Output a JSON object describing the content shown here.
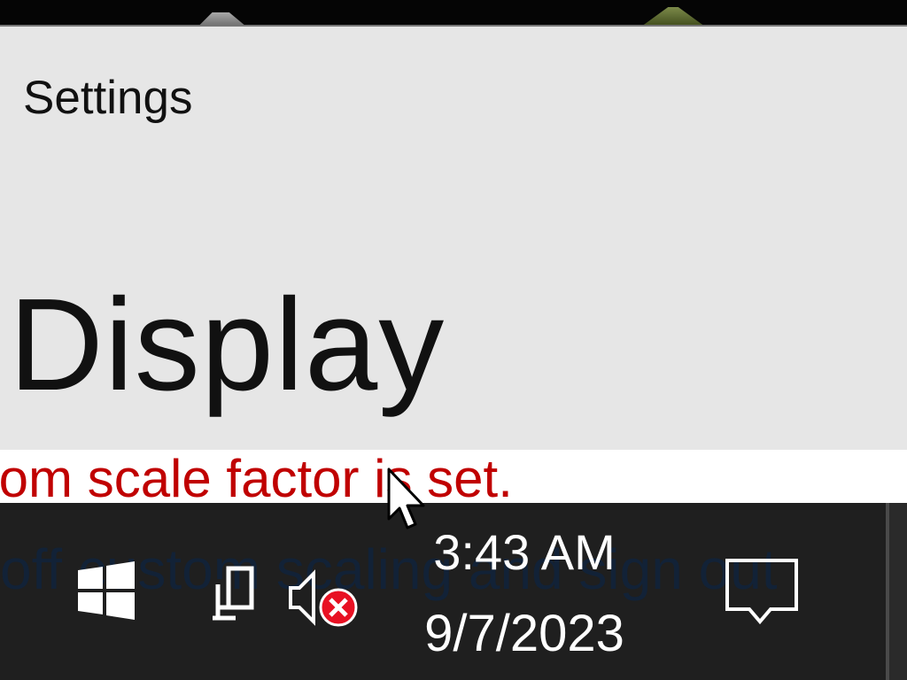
{
  "window": {
    "title": "Settings",
    "heading": "Display",
    "warning": "stom scale factor is set."
  },
  "taskbar": {
    "background_text": "off custom scaling and sign out",
    "start_icon": "windows-logo-icon",
    "network_icon": "network-icon",
    "volume_icon": "volume-muted-icon",
    "clock": {
      "time": "3:43 AM",
      "date": "9/7/2023"
    },
    "action_center_icon": "action-center-icon"
  },
  "colors": {
    "window_bg": "#e6e6e6",
    "taskbar_bg": "#1f1f1f",
    "warning": "#c00000",
    "mute_badge": "#e81123"
  }
}
